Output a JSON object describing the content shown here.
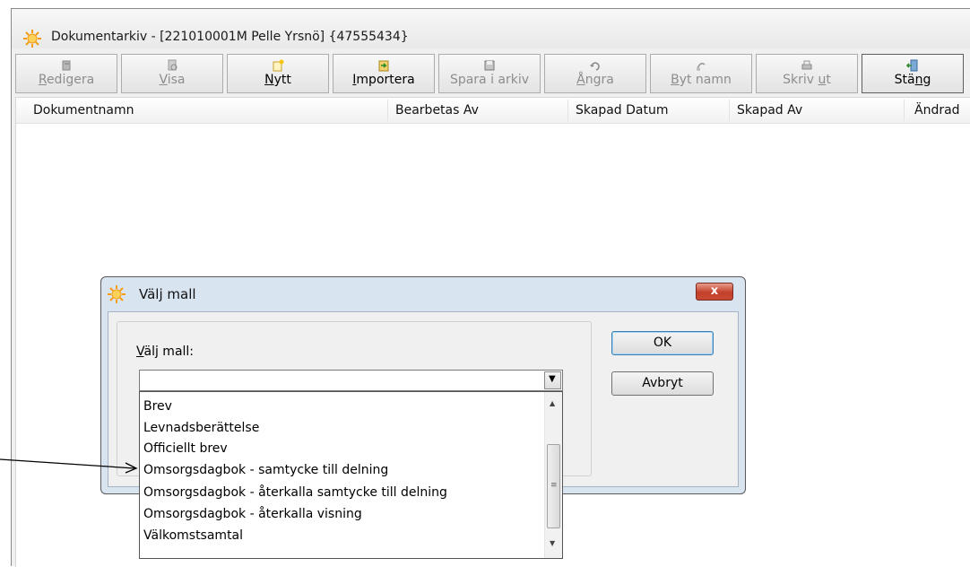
{
  "window": {
    "title": "Dokumentarkiv - [221010001M Pelle Yrsnö] {47555434}"
  },
  "toolbar": {
    "buttons": [
      {
        "label_pre": "",
        "label_ul": "R",
        "label_post": "edigera",
        "icon": "edit-icon",
        "enabled": false
      },
      {
        "label_pre": "",
        "label_ul": "V",
        "label_post": "isa",
        "icon": "view-icon",
        "enabled": false
      },
      {
        "label_pre": "",
        "label_ul": "N",
        "label_post": "ytt",
        "icon": "new-document-icon",
        "enabled": true
      },
      {
        "label_pre": "",
        "label_ul": "I",
        "label_post": "mportera",
        "icon": "import-icon",
        "enabled": true
      },
      {
        "label_pre": "",
        "label_ul": "",
        "label_post": "Spara i arkiv",
        "icon": "save-icon",
        "enabled": false
      },
      {
        "label_pre": "",
        "label_ul": "Å",
        "label_post": "ngra",
        "icon": "undo-icon",
        "enabled": false
      },
      {
        "label_pre": "",
        "label_ul": "B",
        "label_post": "yt namn",
        "icon": "rename-icon",
        "enabled": false
      },
      {
        "label_pre": "Skriv ",
        "label_ul": "u",
        "label_post": "t",
        "icon": "print-icon",
        "enabled": false
      },
      {
        "label_pre": "Stä",
        "label_ul": "n",
        "label_post": "g",
        "icon": "close-door-icon",
        "enabled": true
      }
    ]
  },
  "list": {
    "columns": [
      "Dokumentnamn",
      "Bearbetas Av",
      "Skapad Datum",
      "Skapad Av",
      "Ändrad"
    ]
  },
  "dialog": {
    "title": "Välj mall",
    "close_label": "x",
    "field_label_ul": "V",
    "field_label_post": "älj mall:",
    "combo_value": "",
    "ok_label": "OK",
    "cancel_label": "Avbryt",
    "options": [
      "Brev",
      "Levnadsberättelse",
      "Officiellt brev",
      "Omsorgsdagbok - samtycke till delning",
      "Omsorgsdagbok - återkalla samtycke till delning",
      "Omsorgsdagbok - återkalla visning",
      "Välkomstsamtal"
    ]
  },
  "colors": {
    "dialog_frame": "#d9e4f1",
    "close_red": "#c3402a",
    "window_bg": "#f0f0f0"
  }
}
